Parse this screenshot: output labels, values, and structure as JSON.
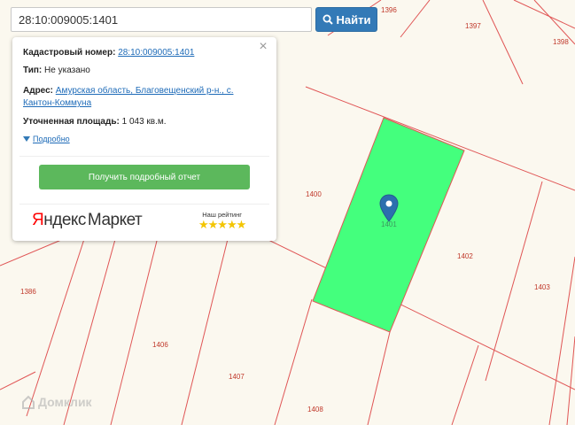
{
  "search": {
    "value": "28:10:009005:1401",
    "button_label": "Найти",
    "button_icon": "search-icon"
  },
  "info_card": {
    "cadastral_label": "Кадастровый номер:",
    "cadastral_value": "28:10:009005:1401",
    "type_label": "Тип:",
    "type_value": "Не указано",
    "address_label": "Адрес:",
    "address_line1": "Амурская область, Благовещенский р-н., с.",
    "address_line2": "Кантон-Коммуна",
    "area_label": "Уточненная площадь:",
    "area_value": "1 043 кв.м.",
    "more_label": "Подробно",
    "report_button": "Получить подробный отчет",
    "ad_brand_first": "Я",
    "ad_brand_rest": "ндекс",
    "ad_brand_product": "Маркет",
    "rating_label": "Наш рейтинг",
    "rating_stars": "★★★★★",
    "rating": 5
  },
  "map": {
    "parcels": [
      "1396",
      "1397",
      "1398",
      "1400",
      "1401",
      "1402",
      "1403",
      "1386",
      "1406",
      "1407",
      "1408"
    ],
    "highlight_color": "#44ff7d",
    "line_color": "#e05555",
    "background_color": "#fbf8ef"
  },
  "watermark": "Домклик"
}
